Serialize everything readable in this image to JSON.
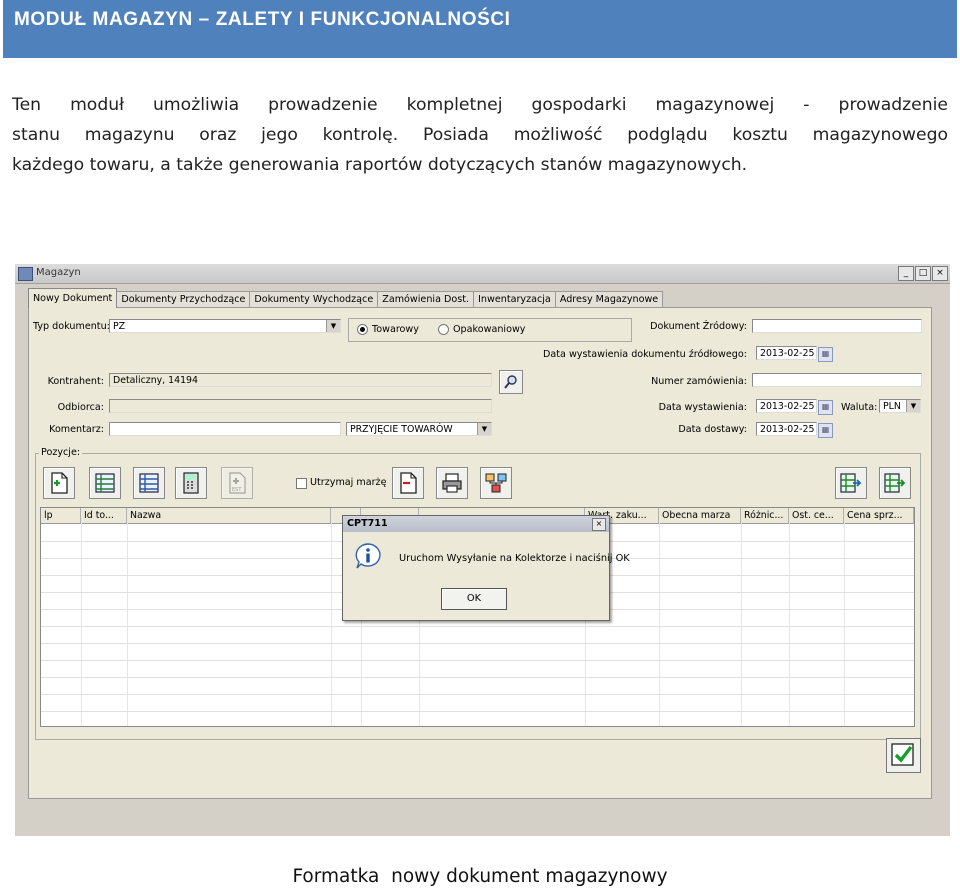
{
  "header": {
    "title": "MODUŁ MAGAZYN – ZALETY I FUNKCJONALNOŚCI"
  },
  "intro": {
    "lines": [
      "Ten moduł umożliwia prowadzenie kompletnej gospodarki magazynowej - prowadzenie",
      "stanu magazynu oraz jego kontrolę. Posiada możliwość podglądu kosztu magazynowego",
      "każdego towaru, a także generowania raportów dotyczących stanów magazynowych."
    ]
  },
  "window": {
    "title": "Magazyn",
    "controls": {
      "minimize": "_",
      "maximize": "□",
      "close": "×"
    },
    "tabs": [
      "Nowy Dokument",
      "Dokumenty Przychodzące",
      "Dokumenty Wychodzące",
      "Zamówienia Dost.",
      "Inwentaryzacja",
      "Adresy Magazynowe"
    ],
    "form": {
      "typ_label": "Typ dokumentu:",
      "typ_value": "PZ",
      "radio_towarowy": "Towarowy",
      "radio_opakowaniowy": "Opakowaniowy",
      "dok_zrodlowy_label": "Dokument Źródowy:",
      "dok_zrodlowy_value": "",
      "data_wyst_zrodl_label": "Data wystawienia dokumentu źródłowego:",
      "data_wyst_zrodl_value": "2013-02-25",
      "kontrahent_label": "Kontrahent:",
      "kontrahent_value": "Detaliczny, 14194",
      "numer_zam_label": "Numer zamówienia:",
      "numer_zam_value": "",
      "odbiorca_label": "Odbiorca:",
      "odbiorca_value": "",
      "data_wyst_label": "Data wystawienia:",
      "data_wyst_value": "2013-02-25",
      "waluta_label": "Waluta:",
      "waluta_value": "PLN",
      "komentarz_label": "Komentarz:",
      "komentarz_value": "",
      "przyjecie_value": "PRZYJĘCIE TOWARÓW",
      "data_dostawy_label": "Data dostawy:",
      "data_dostawy_value": "2013-02-25"
    },
    "pozycje": {
      "label": "Pozycje:",
      "utrzymaj_marze": "Utrzymaj marżę",
      "columns": [
        "lp",
        "Id to...",
        "Nazwa",
        "",
        "",
        "",
        "Wart. zaku...",
        "Obecna marza",
        "Różnic...",
        "Ost. ce...",
        "Cena sprz..."
      ]
    },
    "dialog": {
      "title": "CPT711",
      "close": "×",
      "message": "Uruchom Wysyłanie na Kolektorze i naciśnij OK",
      "ok_label": "OK"
    }
  },
  "caption": "Formatka  nowy dokument magazynowy",
  "colors": {
    "header_bg": "#4f81bd",
    "window_bg": "#d4d0c8",
    "panel_bg": "#ece9d8"
  }
}
